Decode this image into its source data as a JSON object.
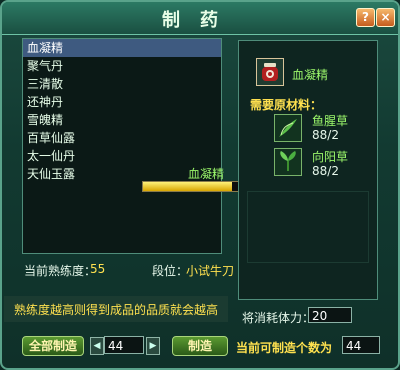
{
  "window": {
    "title": "制药",
    "help_label": "?",
    "close_label": "×"
  },
  "recipes": [
    "血凝精",
    "聚气丹",
    "三清散",
    "还神丹",
    "雪魄精",
    "百草仙露",
    "太一仙丹",
    "天仙玉露"
  ],
  "selected_recipe_index": 0,
  "product": {
    "name": "血凝精",
    "icon": "potion-jar-icon"
  },
  "materials_label": "需要原材料：",
  "materials": [
    {
      "name": "鱼腥草",
      "count": "88/2",
      "icon": "herb-leaf-icon"
    },
    {
      "name": "向阳草",
      "count": "88/2",
      "icon": "herb-leaf-icon"
    }
  ],
  "progress": {
    "label": "血凝精",
    "fraction": 0.75
  },
  "stats": {
    "proficiency_label": "当前熟练度：",
    "proficiency_value": "55",
    "rank_label": "段位：",
    "rank_value": "小试牛刀"
  },
  "hint": "熟练度越高则得到成品的品质就会越高",
  "stamina": {
    "label": "将消耗体力：",
    "value": "20"
  },
  "controls": {
    "make_all_label": "全部制造",
    "quantity": "44",
    "make_label": "制造",
    "can_make_label": "当前可制造个数为",
    "can_make_value": "44"
  },
  "colors": {
    "accent_green": "#9cf86b",
    "accent_yellow": "#ffe14f",
    "selected_row": "#3e5a80"
  }
}
